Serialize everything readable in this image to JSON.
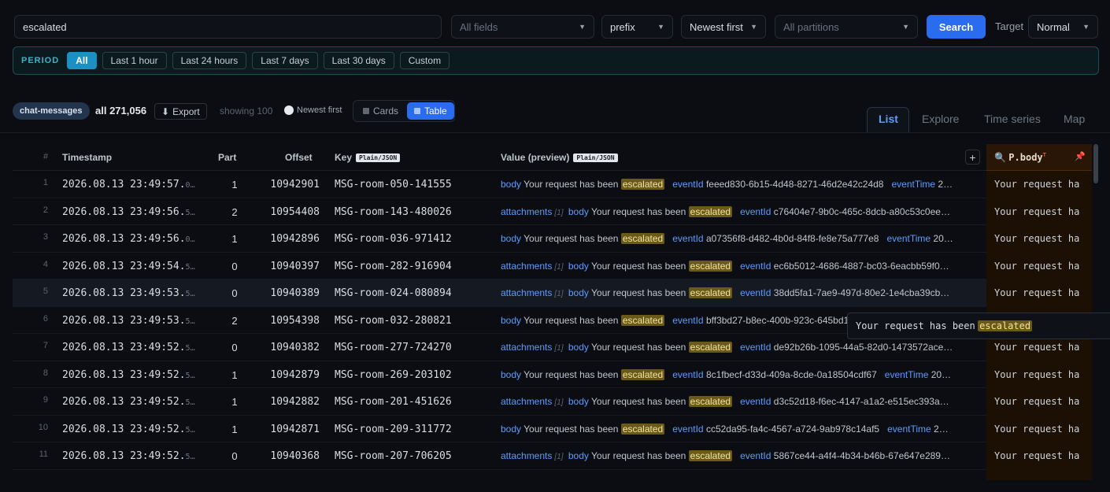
{
  "topbar": {
    "query": "escalated",
    "fields_placeholder": "All fields",
    "match_mode": "prefix",
    "sort": "Newest first",
    "partitions_placeholder": "All partitions",
    "search_label": "Search",
    "target_label": "Target",
    "target_value": "Normal"
  },
  "period": {
    "label": "PERIOD",
    "options": [
      "All",
      "Last 1 hour",
      "Last 24 hours",
      "Last 7 days",
      "Last 30 days",
      "Custom"
    ],
    "selected": "All"
  },
  "toolbar": {
    "topic": "chat-messages",
    "count_label": "all 271,056",
    "export_label": "Export",
    "showing": "showing 100",
    "order": "Newest first",
    "view_cards": "Cards",
    "view_table": "Table",
    "view_selected": "Table"
  },
  "tabs": [
    "List",
    "Explore",
    "Time series",
    "Map"
  ],
  "active_tab": "List",
  "columns": {
    "num": "#",
    "timestamp": "Timestamp",
    "part": "Part",
    "offset": "Offset",
    "key": "Key",
    "key_badge": "Plain/JSON",
    "value": "Value (preview)",
    "value_badge": "Plain/JSON",
    "pinned": "P.body",
    "pinned_sup": "T"
  },
  "rows": [
    {
      "n": "1",
      "ts": "2026.08.13 23:49:57.",
      "frac": "0…",
      "part": "1",
      "offset": "10942901",
      "key": "MSG-room-050-141555",
      "attachments": false,
      "eventId": "feeed830-6b15-4d48-8271-46d2e42c24d8",
      "tail_key": "eventTime",
      "tail_val": "20…",
      "p": "Your request ha"
    },
    {
      "n": "2",
      "ts": "2026.08.13 23:49:56.",
      "frac": "5…",
      "part": "2",
      "offset": "10954408",
      "key": "MSG-room-143-480026",
      "attachments": true,
      "eventId": "c76404e7-9b0c-465c-8dcb-a80c53c0ee7…",
      "tail_key": "",
      "tail_val": "",
      "p": "Your request ha"
    },
    {
      "n": "3",
      "ts": "2026.08.13 23:49:56.",
      "frac": "0…",
      "part": "1",
      "offset": "10942896",
      "key": "MSG-room-036-971412",
      "attachments": false,
      "eventId": "a07356f8-d482-4b0d-84f8-fe8e75a777e8",
      "tail_key": "eventTime",
      "tail_val": "202…",
      "p": "Your request ha"
    },
    {
      "n": "4",
      "ts": "2026.08.13 23:49:54.",
      "frac": "5…",
      "part": "0",
      "offset": "10940397",
      "key": "MSG-room-282-916904",
      "attachments": true,
      "eventId": "ec6b5012-4686-4887-bc03-6eacbb59f05…",
      "tail_key": "",
      "tail_val": "",
      "p": "Your request ha"
    },
    {
      "n": "5",
      "ts": "2026.08.13 23:49:53.",
      "frac": "5…",
      "part": "0",
      "offset": "10940389",
      "key": "MSG-room-024-080894",
      "attachments": true,
      "eventId": "38dd5fa1-7ae9-497d-80e2-1e4cba39cbe…",
      "tail_key": "",
      "tail_val": "",
      "p": "Your request ha"
    },
    {
      "n": "6",
      "ts": "2026.08.13 23:49:53.",
      "frac": "5…",
      "part": "2",
      "offset": "10954398",
      "key": "MSG-room-032-280821",
      "attachments": false,
      "eventId": "bff3bd27-b8ec-400b-923c-645bd14",
      "tail_key": "",
      "tail_val": "",
      "p": ""
    },
    {
      "n": "7",
      "ts": "2026.08.13 23:49:52.",
      "frac": "5…",
      "part": "0",
      "offset": "10940382",
      "key": "MSG-room-277-724270",
      "attachments": true,
      "eventId": "de92b26b-1095-44a5-82d0-1473572ace…",
      "tail_key": "",
      "tail_val": "",
      "p": "Your request ha"
    },
    {
      "n": "8",
      "ts": "2026.08.13 23:49:52.",
      "frac": "5…",
      "part": "1",
      "offset": "10942879",
      "key": "MSG-room-269-203102",
      "attachments": false,
      "eventId": "8c1fbecf-d33d-409a-8cde-0a18504cdf67",
      "tail_key": "eventTime",
      "tail_val": "202…",
      "p": "Your request ha"
    },
    {
      "n": "9",
      "ts": "2026.08.13 23:49:52.",
      "frac": "5…",
      "part": "1",
      "offset": "10942882",
      "key": "MSG-room-201-451626",
      "attachments": true,
      "eventId": "d3c52d18-f6ec-4147-a1a2-e515ec393ae…",
      "tail_key": "",
      "tail_val": "",
      "p": "Your request ha"
    },
    {
      "n": "10",
      "ts": "2026.08.13 23:49:52.",
      "frac": "5…",
      "part": "1",
      "offset": "10942871",
      "key": "MSG-room-209-311772",
      "attachments": false,
      "eventId": "cc52da95-fa4c-4567-a724-9ab978c14af5",
      "tail_key": "eventTime",
      "tail_val": "202…",
      "p": "Your request ha"
    },
    {
      "n": "11",
      "ts": "2026.08.13 23:49:52.",
      "frac": "5…",
      "part": "0",
      "offset": "10940368",
      "key": "MSG-room-207-706205",
      "attachments": true,
      "eventId": "5867ce44-a4f4-4b34-b46b-67e647e2893…",
      "tail_key": "",
      "tail_val": "",
      "p": "Your request ha"
    }
  ],
  "value_text": {
    "body_key": "body",
    "attachments_key": "attachments",
    "attachments_count": "[1]",
    "body_prefix": "Your request has been",
    "highlight": "escalated",
    "eventId_key": "eventId"
  },
  "tooltip": {
    "prefix": "Your request has been",
    "highlight": "escalated"
  },
  "hover_row": 4
}
